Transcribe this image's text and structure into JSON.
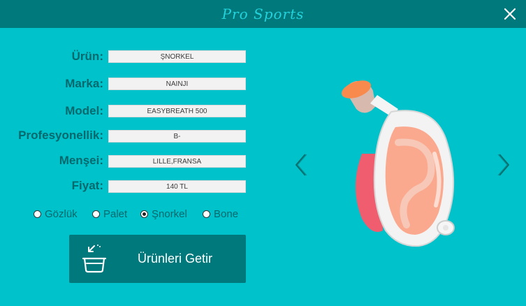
{
  "app": {
    "title": "Pro Sports"
  },
  "form": {
    "fields": [
      {
        "label": "Ürün",
        "value": "ŞNORKEL"
      },
      {
        "label": "Marka",
        "value": "NAINJI"
      },
      {
        "label": "Model",
        "value": "EASYBREATH 500"
      },
      {
        "label": "Profesyonellik",
        "value": "B-"
      },
      {
        "label": "Menşei",
        "value": "LILLE,FRANSA"
      },
      {
        "label": "Fiyat",
        "value": "140 TL"
      }
    ],
    "colon": ":"
  },
  "categories": {
    "options": [
      {
        "label": "Gözlük",
        "checked": false
      },
      {
        "label": "Palet",
        "checked": false
      },
      {
        "label": "Şnorkel",
        "checked": true
      },
      {
        "label": "Bone",
        "checked": false
      }
    ]
  },
  "fetch_button": {
    "label": "Ürünleri Getir",
    "icon": "basket-download-icon"
  },
  "gallery": {
    "prev_icon": "chevron-left-icon",
    "next_icon": "chevron-right-icon",
    "image": "full-face-snorkel-mask"
  },
  "colors": {
    "background": "#00C2CB",
    "titlebar": "#00797C",
    "title_text": "#22D3DC",
    "label_text": "#00696D",
    "button": "#00797C"
  }
}
